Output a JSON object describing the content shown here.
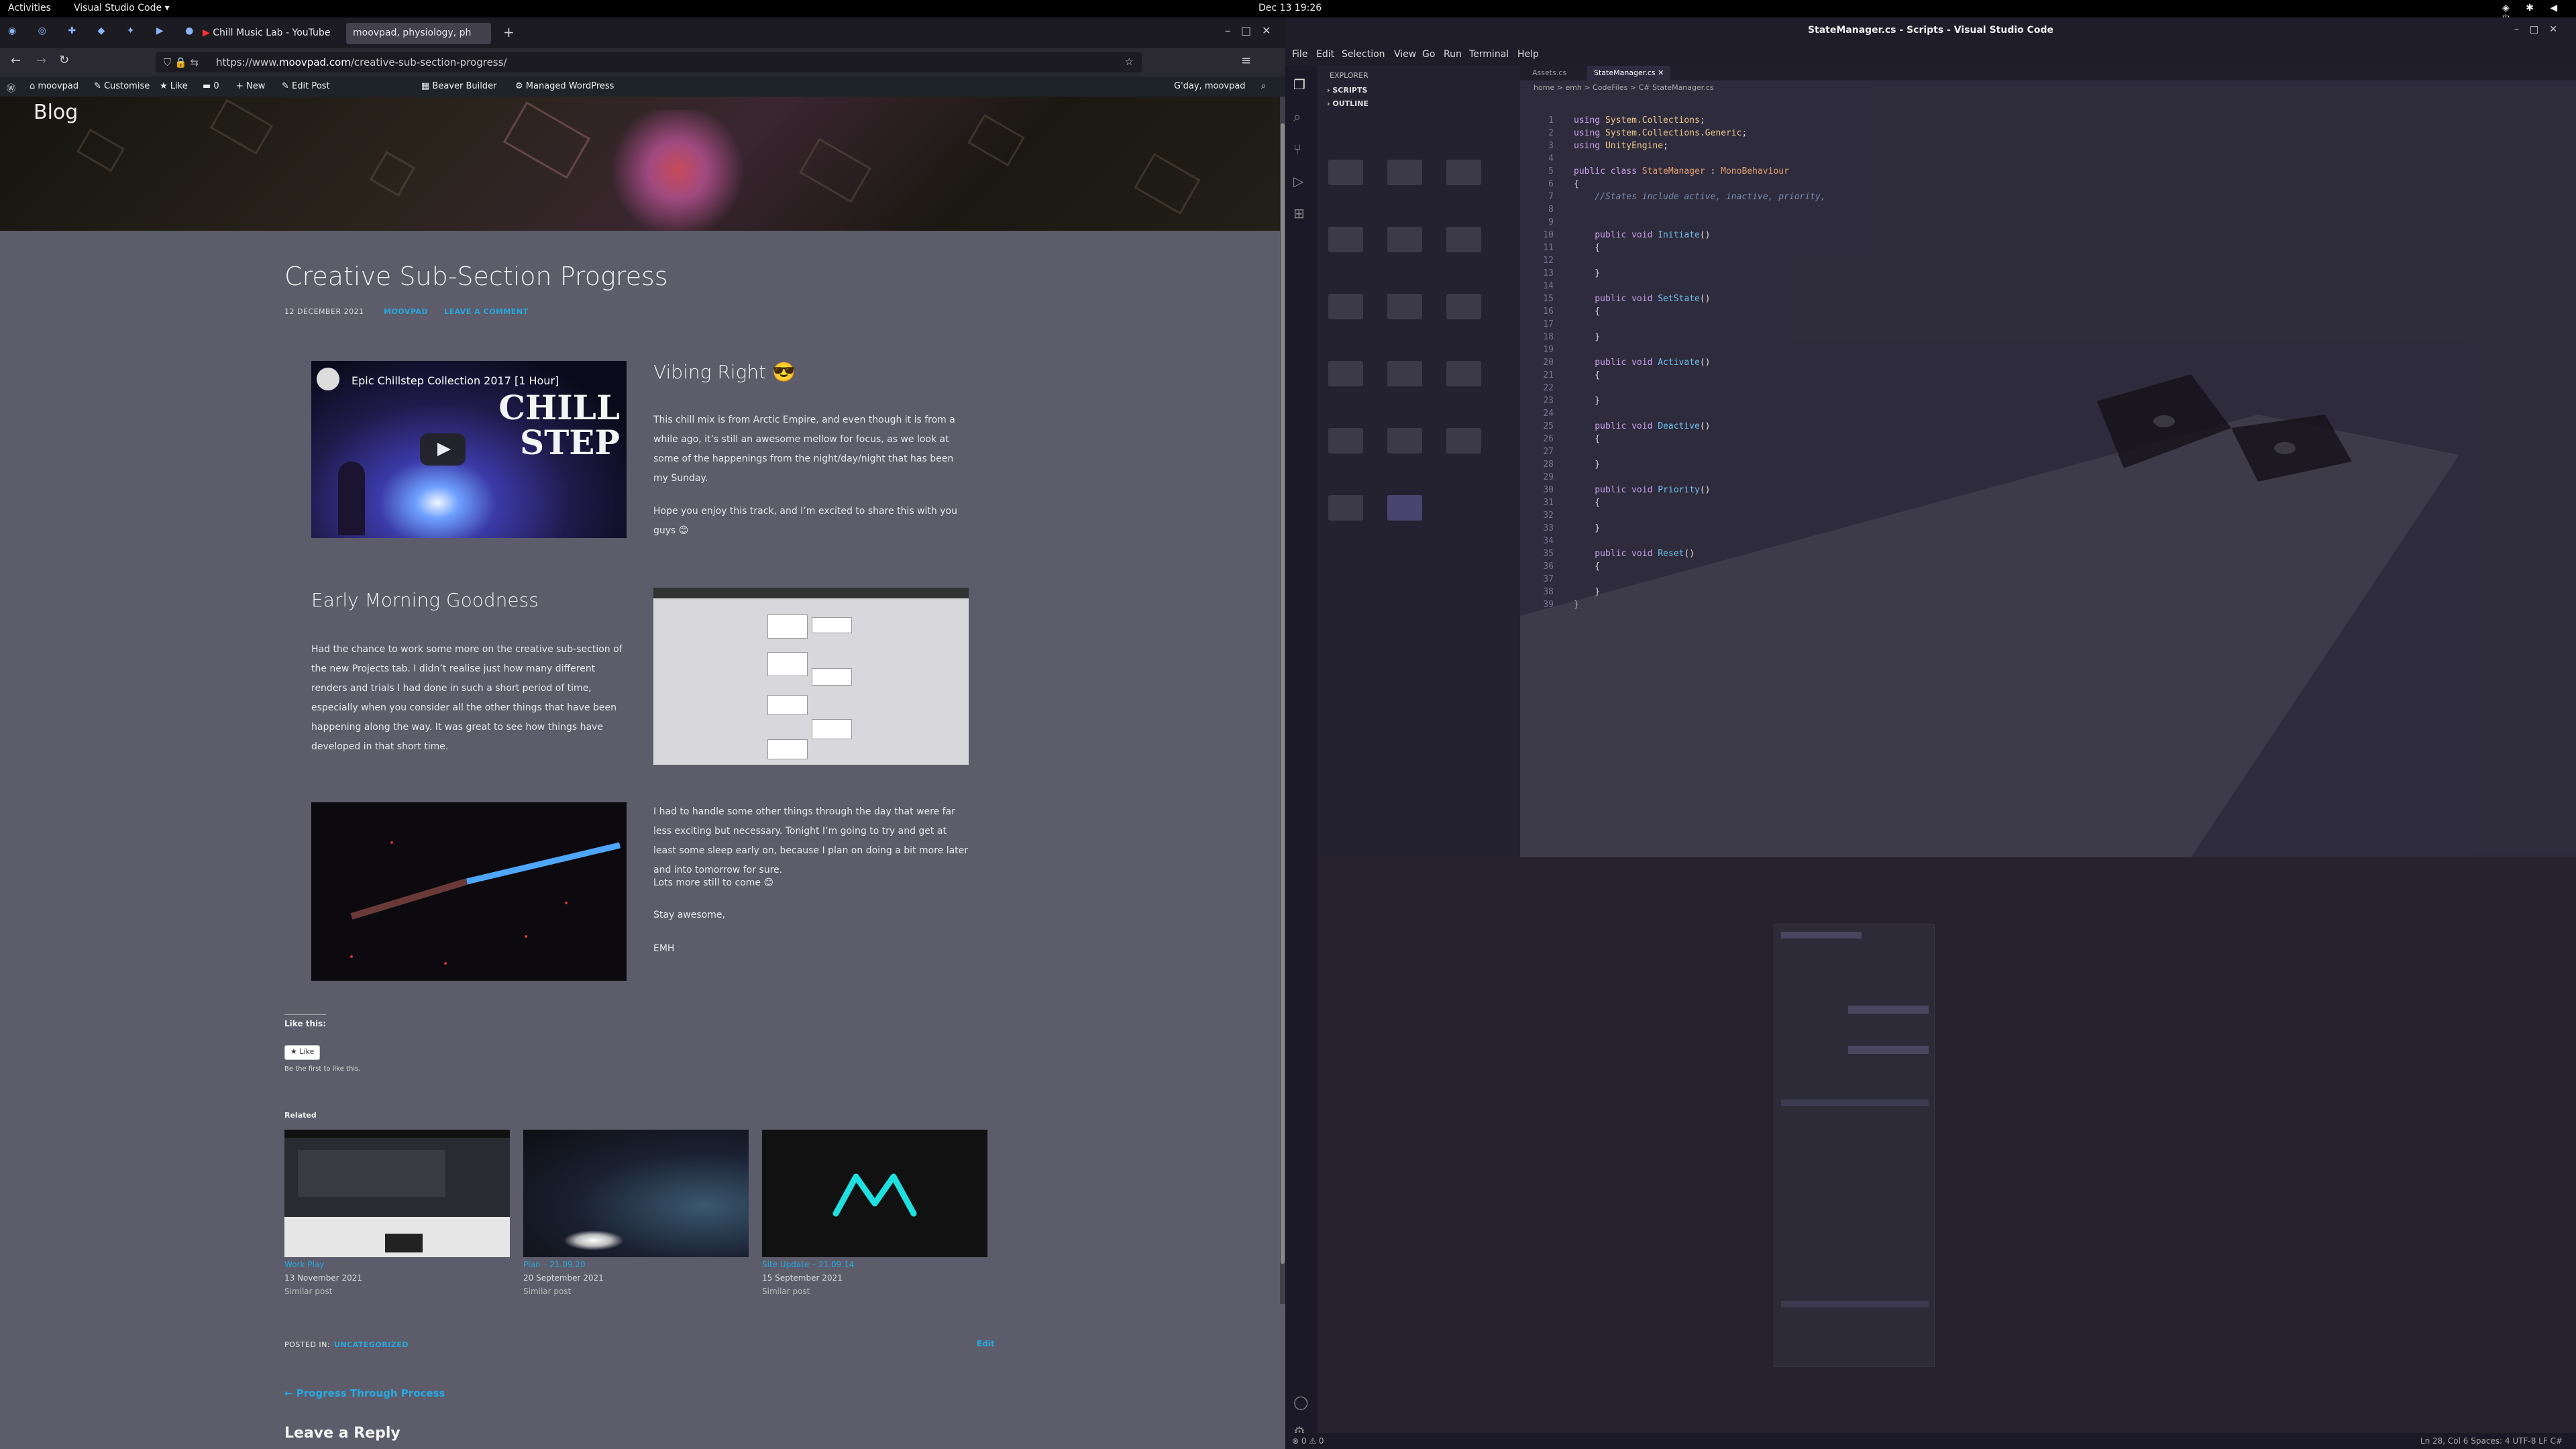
{
  "topbar": {
    "activities": "Activities",
    "app_menu": "Visual Studio Code ▾",
    "clock": "Dec 13  19:26"
  },
  "browser": {
    "tabs": [
      {
        "label": "Chill Music Lab - YouTube"
      },
      {
        "label": "moovpad, physiology, ph"
      }
    ],
    "url_prefix": "https://www.",
    "url_host": "moovpad.com",
    "url_path": "/creative-sub-section-progress/",
    "wp_bar": {
      "site": "moovpad",
      "customise": "Customise",
      "like": "Like",
      "comments": "0",
      "new": "New",
      "edit_post": "Edit Post",
      "beaver": "Beaver Builder",
      "managed": "Managed WordPress",
      "greeting": "G'day, moovpad"
    },
    "header_blog": "Blog"
  },
  "post": {
    "title": "Creative Sub-Section Progress",
    "date": "12 DECEMBER 2021",
    "author": "MOOVPAD",
    "comment_link": "LEAVE A COMMENT",
    "video_title": "Epic Chillstep Collection 2017 [1 Hour]",
    "video_art_text": "CHILL STEP",
    "section1_heading": "Vibing Right 😎",
    "section1_p1": "This chill mix is from Arctic Empire, and even though it is from a while ago, it’s still an awesome mellow for focus, as we look at some of the happenings from the night/day/night that has been my Sunday.",
    "section1_p2": "Hope you enjoy this track, and I’m excited to share this with you guys 😊",
    "section2_heading": "Early Morning Goodness",
    "section2_p": "Had the chance to work some more on the creative sub-section of the new Projects tab. I didn’t realise just how many different renders and trials I had done in such a short period of time, especially when you consider all the other things that have been happening along the way. It was great to see how things have developed in that short time.",
    "section3_p1": "I had to handle some other things through the day that were far less exciting but necessary. Tonight I’m going to try and get at least some sleep early on, because I plan on doing a bit more later and into tomorrow for sure.",
    "section3_p2": "Lots more still to come 😊",
    "section3_p3": "Stay awesome,",
    "section3_sig": "EMH",
    "like_heading": "Like this:",
    "like_button": "Like",
    "like_first": "Be the first to like this.",
    "related_heading": "Related",
    "related": [
      {
        "title": "Work Play",
        "date": "13 November 2021",
        "sub": "Similar post"
      },
      {
        "title": "Plan – 21.09.20",
        "date": "20 September 2021",
        "sub": "Similar post"
      },
      {
        "title": "Site Update – 21.09.14",
        "date": "15 September 2021",
        "sub": "Similar post"
      }
    ],
    "posted_in_label": "POSTED IN:",
    "posted_in_value": "UNCATEGORIZED",
    "edit_link": "Edit",
    "prev_post": "← Progress Through Process",
    "reply_heading": "Leave a Reply"
  },
  "vscode": {
    "title": "StateManager.cs - Scripts - Visual Studio Code",
    "menu": [
      "File",
      "Edit",
      "Selection",
      "View",
      "Go",
      "Run",
      "Terminal",
      "Help"
    ],
    "explorer_label": "EXPLORER",
    "scripts_label": "SCRIPTS",
    "outline_label": "OUTLINE",
    "tab_inactive": "Assets.cs",
    "tab_active": "StateManager.cs",
    "breadcrumb": "home > emh > CodeFiles > C# StateManager.cs",
    "status_right": "Ln 28, Col 6   Spaces: 4   UTF-8   LF   C#",
    "status_left": "⊗ 0 ⚠ 0",
    "code_lines": [
      [
        "kw:using ",
        "ns:System.Collections",
        "t:;"
      ],
      [
        "kw:using ",
        "ns:System.Collections.Generic",
        "t:;"
      ],
      [
        "kw:using ",
        "ns:UnityEngine",
        "t:;"
      ],
      [],
      [
        "kw:public class ",
        "ty:StateManager",
        "t: : ",
        "ty:MonoBehaviour"
      ],
      [
        "t:{"
      ],
      [
        "cm:    //States include active, inactive, priority,"
      ],
      [],
      [],
      [
        "kw:    public void ",
        "fn:Initiate",
        "t:()"
      ],
      [
        "t:    {"
      ],
      [],
      [
        "t:    }"
      ],
      [],
      [
        "kw:    public void ",
        "fn:SetState",
        "t:()"
      ],
      [
        "t:    {"
      ],
      [],
      [
        "t:    }"
      ],
      [],
      [
        "kw:    public void ",
        "fn:Activate",
        "t:()"
      ],
      [
        "t:    {"
      ],
      [],
      [
        "t:    }"
      ],
      [],
      [
        "kw:    public void ",
        "fn:Deactive",
        "t:()"
      ],
      [
        "t:    {"
      ],
      [],
      [
        "t:    }"
      ],
      [],
      [
        "kw:    public void ",
        "fn:Priority",
        "t:()"
      ],
      [
        "t:    {"
      ],
      [],
      [
        "t:    }"
      ],
      [],
      [
        "kw:    public void ",
        "fn:Reset",
        "t:()"
      ],
      [
        "t:    {"
      ],
      [],
      [
        "t:    }"
      ],
      [
        "t:}"
      ]
    ]
  }
}
